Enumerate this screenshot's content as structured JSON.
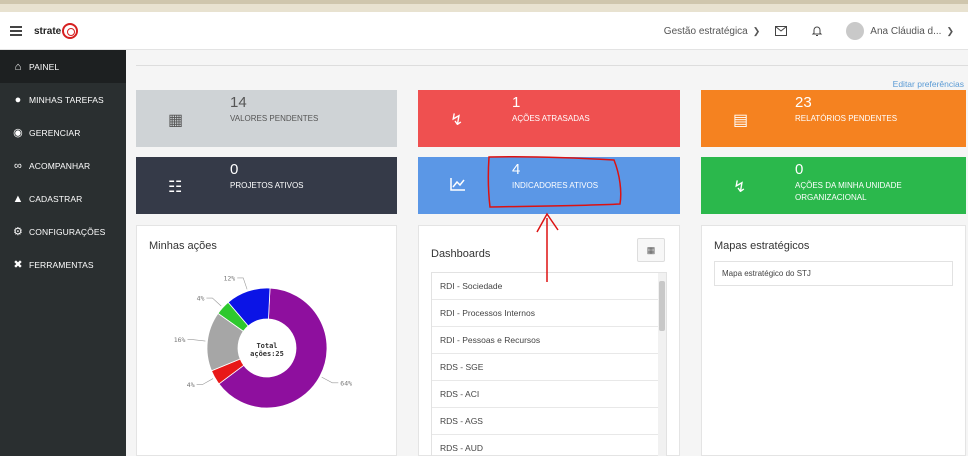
{
  "header": {
    "logo_text": "strate",
    "context_menu": "Gestão estratégica",
    "user_name": "Ana Cláudia d..."
  },
  "sidebar": {
    "items": [
      {
        "label": "PAINEL",
        "icon": "home-icon"
      },
      {
        "label": "MINHAS TAREFAS",
        "icon": "users-icon"
      },
      {
        "label": "GERENCIAR",
        "icon": "dashboard-icon"
      },
      {
        "label": "ACOMPANHAR",
        "icon": "binoculars-icon"
      },
      {
        "label": "CADASTRAR",
        "icon": "add-user-icon"
      },
      {
        "label": "CONFIGURAÇÕES",
        "icon": "gear-icon"
      },
      {
        "label": "FERRAMENTAS",
        "icon": "tools-icon"
      }
    ]
  },
  "main": {
    "edit_preferences": "Editar preferências",
    "cards": [
      {
        "number": "14",
        "label": "VALORES PENDENTES",
        "icon": "calculator-icon",
        "color": "#cfd3d6"
      },
      {
        "number": "1",
        "label": "AÇÕES ATRASADAS",
        "icon": "lightning-icon",
        "color": "#ef5050"
      },
      {
        "number": "23",
        "label": "RELATÓRIOS PENDENTES",
        "icon": "file-icon",
        "color": "#f58220"
      },
      {
        "number": "0",
        "label": "PROJETOS ATIVOS",
        "icon": "sitemap-icon",
        "color": "#353a48"
      },
      {
        "number": "4",
        "label": "INDICADORES ATIVOS",
        "icon": "line-chart-icon",
        "color": "#5b97e6"
      },
      {
        "number": "0",
        "label": "AÇÕES DA MINHA UNIDADE",
        "label2": "ORGANIZACIONAL",
        "icon": "lightning-icon",
        "color": "#2bb84c"
      }
    ],
    "minhas_acoes": {
      "title": "Minhas ações",
      "center_label": "Total",
      "center_value": "ações:25"
    },
    "dashboards": {
      "title": "Dashboards",
      "items": [
        "RDI - Sociedade",
        "RDI - Processos Internos",
        "RDI - Pessoas e Recursos",
        "RDS - SGE",
        "RDS - ACI",
        "RDS - AGS",
        "RDS - AUD"
      ]
    },
    "mapas": {
      "title": "Mapas estratégicos",
      "item": "Mapa estratégico do STJ"
    }
  },
  "chart_data": {
    "type": "pie",
    "slices": [
      {
        "label": "64%",
        "value": 64,
        "color": "#8e0f9e"
      },
      {
        "label": "4%",
        "value": 4,
        "color": "#e81818"
      },
      {
        "label": "16%",
        "value": 16,
        "color": "#a6a6a6"
      },
      {
        "label": "4%",
        "value": 4,
        "color": "#2ec82e"
      },
      {
        "label": "12%",
        "value": 12,
        "color": "#0b14e6"
      }
    ]
  }
}
